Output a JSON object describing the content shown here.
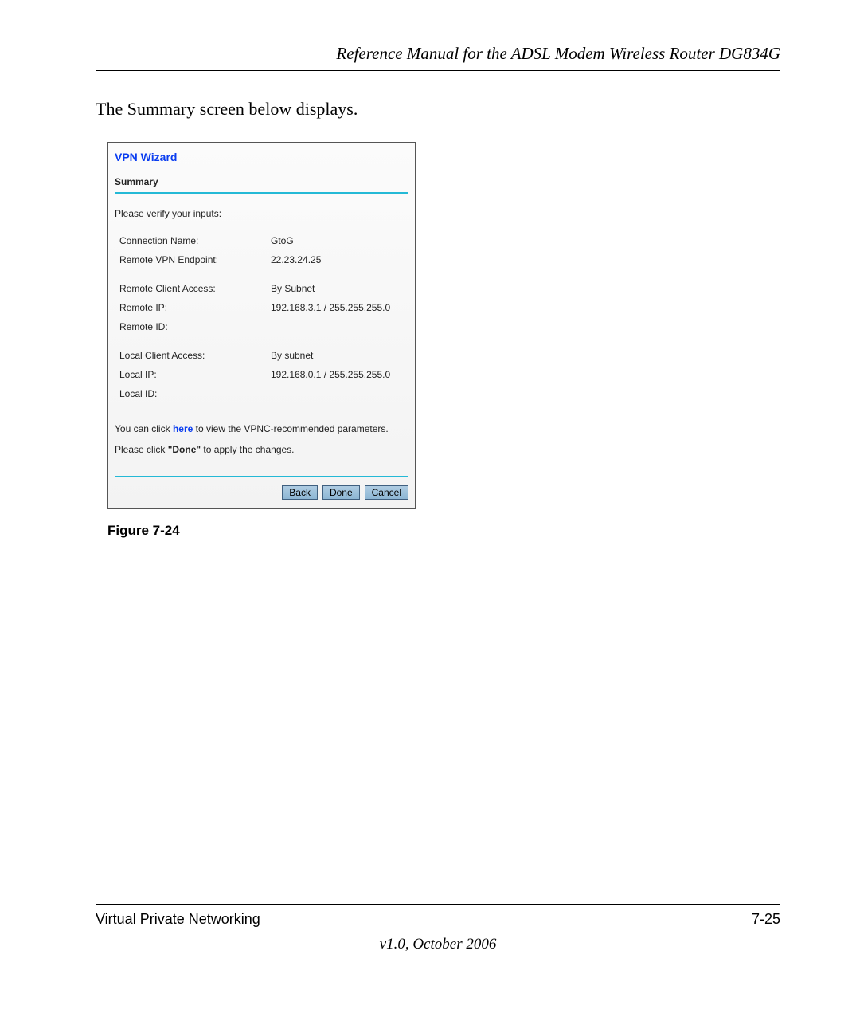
{
  "doc_header": "Reference Manual for the ADSL Modem Wireless Router DG834G",
  "intro_text": "The Summary screen below displays.",
  "wizard": {
    "title": "VPN Wizard",
    "section": "Summary",
    "verify": "Please verify your inputs:",
    "group1": [
      {
        "label": "Connection Name:",
        "value": "GtoG"
      },
      {
        "label": "Remote VPN Endpoint:",
        "value": "22.23.24.25"
      }
    ],
    "group2": [
      {
        "label": "Remote Client Access:",
        "value": "By Subnet"
      },
      {
        "label": "Remote IP:",
        "value": "192.168.3.1 / 255.255.255.0"
      },
      {
        "label": "Remote ID:",
        "value": ""
      }
    ],
    "group3": [
      {
        "label": "Local Client Access:",
        "value": "By subnet"
      },
      {
        "label": "Local IP:",
        "value": "192.168.0.1 / 255.255.255.0"
      },
      {
        "label": "Local ID:",
        "value": ""
      }
    ],
    "vpnc_pre": "You can click ",
    "vpnc_here": "here",
    "vpnc_post": " to view the VPNC-recommended parameters.",
    "done_pre": "Please click ",
    "done_bold": "\"Done\"",
    "done_post": " to apply the changes.",
    "buttons": {
      "back": "Back",
      "done": "Done",
      "cancel": "Cancel"
    }
  },
  "figure_caption": "Figure 7-24",
  "footer": {
    "left": "Virtual Private Networking",
    "right": "7-25",
    "center": "v1.0, October 2006"
  }
}
